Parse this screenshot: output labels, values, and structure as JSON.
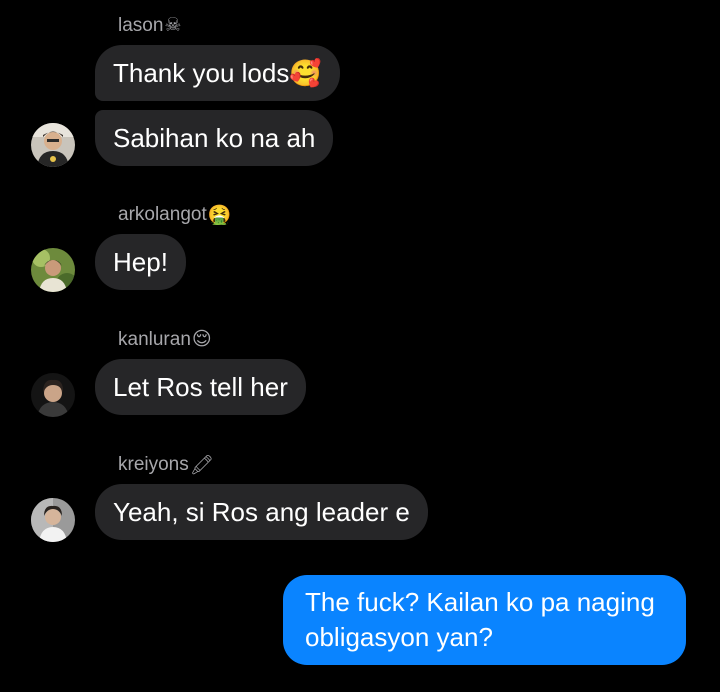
{
  "messages": [
    {
      "sender": "lason",
      "sender_emoji": "☠",
      "bubbles": [
        "Thank you lods🥰",
        "Sabihan ko na ah"
      ]
    },
    {
      "sender": "arkolangot",
      "sender_emoji": "🤮",
      "bubbles": [
        "Hep!"
      ]
    },
    {
      "sender": "kanluran",
      "sender_emoji": "😌",
      "bubbles": [
        "Let Ros tell her"
      ]
    },
    {
      "sender": "kreiyons",
      "sender_emoji": "🖍",
      "bubbles": [
        "Yeah, si Ros ang leader e"
      ]
    }
  ],
  "outgoing": {
    "line1": "The fuck? Kailan ko pa naging",
    "line2": "obligasyon yan?"
  },
  "colors": {
    "background": "#000000",
    "incoming_bubble": "#262628",
    "outgoing_bubble": "#0a84ff",
    "sender_name": "#a7a7ab",
    "text": "#ffffff"
  }
}
